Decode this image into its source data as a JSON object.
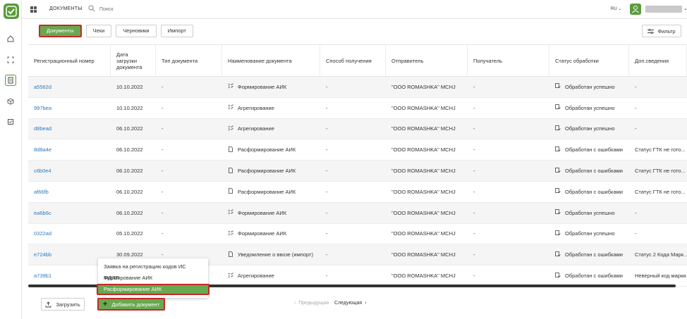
{
  "topbar": {
    "title": "ДОКУМЕНТЫ",
    "search_placeholder": "Поиск",
    "lang": "RU"
  },
  "tabs": [
    {
      "label": "Документы",
      "active": true
    },
    {
      "label": "Чеки",
      "active": false
    },
    {
      "label": "Черновики",
      "active": false
    },
    {
      "label": "Импорт",
      "active": false
    }
  ],
  "filter_label": "Фильтр",
  "table": {
    "headers": [
      "Регистрационный номер",
      "Дата загрузки документа",
      "Тип документа",
      "Наименование документа",
      "Способ получения",
      "Отправитель",
      "Получатель",
      "Статус обработки",
      "Доп.сведения"
    ],
    "rows": [
      {
        "id": "a5562d",
        "date": "10.10.2022",
        "type": "-",
        "name": "Формирование АИК",
        "name_icon": "checklist-icon",
        "method": "-",
        "sender": "\"OOO ROMASHKA\" MCHJ",
        "receiver": "-",
        "status": "Обработан успешно",
        "extra": "-"
      },
      {
        "id": "997bea",
        "date": "10.10.2022",
        "type": "-",
        "name": "Агрегирование",
        "name_icon": "checklist-icon",
        "method": "-",
        "sender": "\"OOO ROMASHKA\" MCHJ",
        "receiver": "-",
        "status": "Обработан успешно",
        "extra": "-"
      },
      {
        "id": "d8bead",
        "date": "06.10.2022",
        "type": "-",
        "name": "Агрегирование",
        "name_icon": "checklist-icon",
        "method": "-",
        "sender": "\"OOO ROMASHKA\" MCHJ",
        "receiver": "-",
        "status": "Обработан успешно",
        "extra": "-"
      },
      {
        "id": "8d8a4e",
        "date": "06.10.2022",
        "type": "-",
        "name": "Расформирование АИК",
        "name_icon": "document-icon",
        "method": "-",
        "sender": "\"OOO ROMASHKA\" MCHJ",
        "receiver": "-",
        "status": "Обработан с ошибками",
        "extra": "Статус ГТК не гото..."
      },
      {
        "id": "c6b0e4",
        "date": "06.10.2022",
        "type": "-",
        "name": "Расформирование АИК",
        "name_icon": "document-icon",
        "method": "-",
        "sender": "\"OOO ROMASHKA\" MCHJ",
        "receiver": "-",
        "status": "Обработан с ошибками",
        "extra": "Статус ГТК не гото..."
      },
      {
        "id": "af66fb",
        "date": "06.10.2022",
        "type": "-",
        "name": "Расформирование АИК",
        "name_icon": "document-icon",
        "method": "-",
        "sender": "\"OOO ROMASHKA\" MCHJ",
        "receiver": "-",
        "status": "Обработан с ошибками",
        "extra": "Статус ГТК не гото..."
      },
      {
        "id": "ea6b6c",
        "date": "06.10.2022",
        "type": "-",
        "name": "Формирование АИК",
        "name_icon": "checklist-icon",
        "method": "-",
        "sender": "\"OOO ROMASHKA\" MCHJ",
        "receiver": "-",
        "status": "Обработан успешно",
        "extra": "-"
      },
      {
        "id": "0322ad",
        "date": "05.10.2022",
        "type": "-",
        "name": "Формирование АИК",
        "name_icon": "checklist-icon",
        "method": "-",
        "sender": "\"OOO ROMASHKA\" MCHJ",
        "receiver": "-",
        "status": "Обработан успешно",
        "extra": "-"
      },
      {
        "id": "e724bb",
        "date": "30.09.2022",
        "type": "-",
        "name": "Уведомление о ввозе (импорт)",
        "name_icon": "document-icon",
        "method": "-",
        "sender": "\"OOO ROMASHKA\" MCHJ",
        "receiver": "-",
        "status": "Обработан с ошибками",
        "extra": "Статус 2 Кода Марк..."
      },
      {
        "id": "a739b1",
        "date": "",
        "type": "",
        "name": "Агрегирование",
        "name_icon": "checklist-icon",
        "method": "-",
        "sender": "\"OOO ROMASHKA\" MCHJ",
        "receiver": "-",
        "status": "Обработан с ошибками",
        "extra": "Неверный код марки..."
      }
    ]
  },
  "menu": {
    "items": [
      "Заявка на регистрацию кодов ИС МДЛП",
      "Формирование АИК",
      "Расформирование АИК"
    ]
  },
  "footer": {
    "upload_label": "Загрузить",
    "add_label": "Добавить документ",
    "prev_label": "Предыдущая",
    "next_label": "Следующая"
  }
}
